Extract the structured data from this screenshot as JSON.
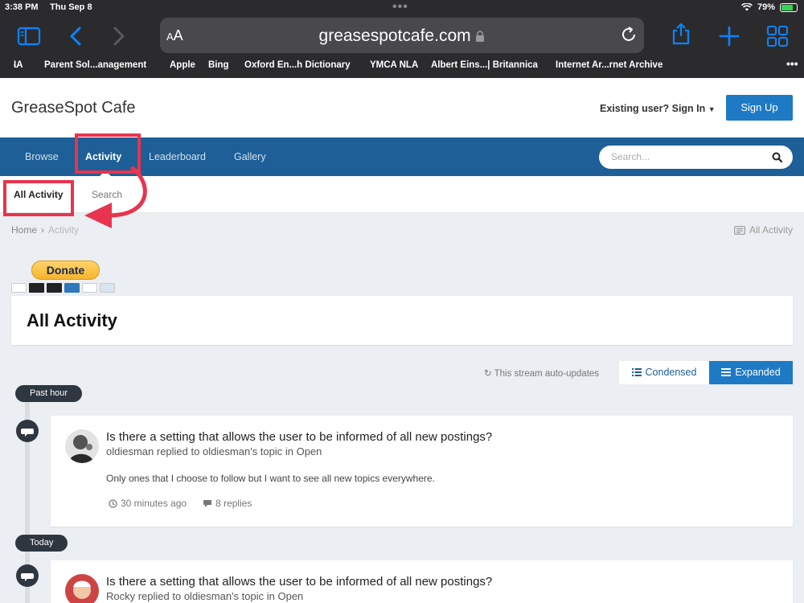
{
  "status": {
    "time": "3:38 PM",
    "date": "Thu Sep 8",
    "battery": "79%",
    "battery_level": 0.79
  },
  "browser": {
    "text_size": "AA",
    "domain": "greasespotcafe.com",
    "bookmarks": [
      "IA",
      "Parent Sol...anagement",
      "Apple",
      "Bing",
      "Oxford En...h Dictionary",
      "YMCA NLA",
      "Albert Eins...| Britannica",
      "Internet Ar...rnet Archive"
    ]
  },
  "site": {
    "logo": "GreaseSpot Cafe",
    "signin": "Existing user? Sign In",
    "signup": "Sign Up"
  },
  "nav": {
    "tabs": [
      "Browse",
      "Activity",
      "Leaderboard",
      "Gallery"
    ],
    "search_placeholder": "Search..."
  },
  "subnav": {
    "items": [
      "All Activity",
      "Search"
    ]
  },
  "breadcrumb": {
    "home": "Home",
    "current": "Activity",
    "right": "All Activity"
  },
  "donate": {
    "label": "Donate"
  },
  "page": {
    "title": "All Activity",
    "auto_updates": "This stream auto-updates",
    "view_condensed": "Condensed",
    "view_expanded": "Expanded"
  },
  "stream": {
    "groups": [
      {
        "label": "Past hour",
        "entry": {
          "title": "Is there a setting that allows the user to be informed of all new postings?",
          "subtitle": "oldiesman replied to oldiesman's topic in Open",
          "snippet": "Only ones that I choose to follow but I want to see all new topics everywhere.",
          "time": "30 minutes ago",
          "replies": "8 replies"
        }
      },
      {
        "label": "Today",
        "entry": {
          "title": "Is there a setting that allows the user to be informed of all new postings?",
          "subtitle": "Rocky replied to oldiesman's topic in Open"
        }
      }
    ]
  },
  "colors": {
    "nav_blue": "#1d5f96",
    "button_blue": "#1e7ac5",
    "annotation_red": "#e8344e",
    "ios_blue": "#0a84ff"
  }
}
